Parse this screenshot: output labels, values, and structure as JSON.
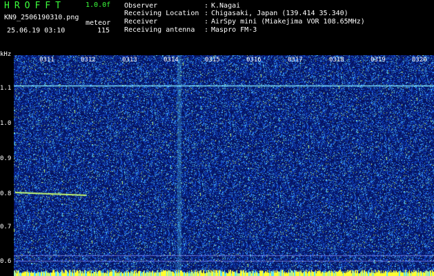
{
  "header": {
    "app_title": "HROFFT",
    "version": "1.0.0f",
    "filename": "KN9_2506190310.png",
    "mode": "meteor",
    "timestamp": "25.06.19 03:10",
    "count": "115",
    "info": [
      {
        "label": "Observer",
        "value": "K.Nagai"
      },
      {
        "label": "Receiving Location",
        "value": "Chigasaki, Japan (139.414 35.340)"
      },
      {
        "label": "Receiver",
        "value": "AirSpy mini (Miakejima VOR 108.65MHz)"
      },
      {
        "label": "Receiving antenna",
        "value": "Maspro FM-3"
      }
    ],
    "separator": ":"
  },
  "axes": {
    "y_unit": "kHz",
    "y_ticks": [
      "1.1",
      "1.0",
      "0.9",
      "0.8",
      "0.7",
      "0.6"
    ],
    "x_ticks": [
      "0311",
      "0312",
      "0313",
      "0314",
      "0315",
      "0316",
      "0317",
      "0318",
      "0319",
      "0320"
    ]
  },
  "colors": {
    "background": "#06125a",
    "noise_low": "#0a2a9a",
    "noise_mid": "#1e6cff",
    "noise_high": "#5fe0ff",
    "hot": "#ffff30",
    "text_green": "#3cff3c"
  }
}
